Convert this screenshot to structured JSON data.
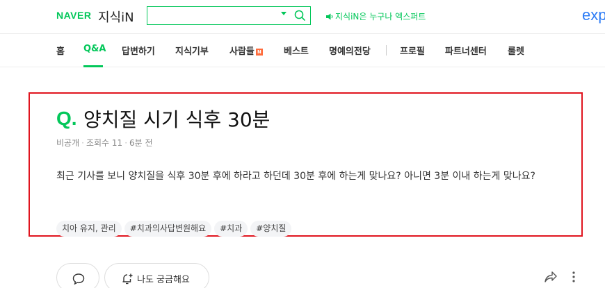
{
  "header": {
    "logo_brand": "NAVER",
    "logo_service": "지식iN",
    "search": {
      "value": "",
      "placeholder": ""
    },
    "notice_text": "지식iN은 누구나 엑스퍼트",
    "expert_link": "exp"
  },
  "nav": {
    "items": [
      {
        "label": "홈"
      },
      {
        "label": "Q&A",
        "active": true
      },
      {
        "label": "답변하기"
      },
      {
        "label": "지식기부"
      },
      {
        "label": "사람들",
        "badge": "N"
      },
      {
        "label": "베스트"
      },
      {
        "label": "명예의전당"
      },
      {
        "label": "프로필"
      },
      {
        "label": "파트너센터"
      },
      {
        "label": "룰렛"
      }
    ]
  },
  "question": {
    "mark": "Q.",
    "title": "양치질 시기 식후 30분",
    "meta": {
      "visibility": "비공개",
      "views_label": "조회수",
      "views": "11",
      "time": "6분 전"
    },
    "body": "최근 기사를 보니 양치질을 식후 30분 후에 하라고 하던데 30분 후에 하는게 맞나요? 아니면 3분 이내 하는게 맞나요?",
    "tags": [
      "치아 유지, 관리",
      "#치과의사답변원해요",
      "#치과",
      "#양치질"
    ]
  },
  "actions": {
    "wonder_label": "나도 궁금해요"
  },
  "colors": {
    "brand_green": "#03c75a",
    "highlight_red": "#e0141e",
    "expert_blue": "#2d7cf6",
    "badge_orange": "#ff6c3c"
  }
}
